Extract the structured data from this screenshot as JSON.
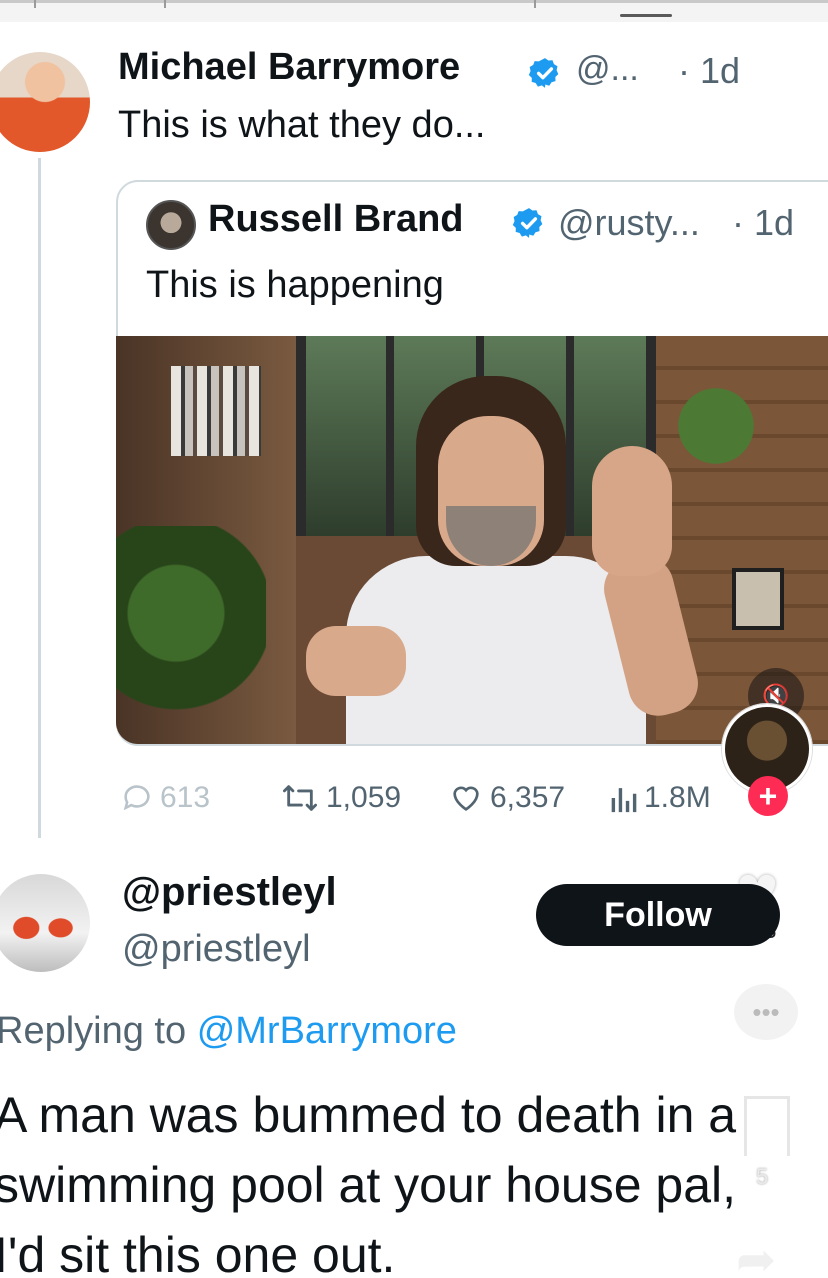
{
  "main_tweet": {
    "author_name": "Michael Barrymore",
    "handle": "@...",
    "time": "· 1d",
    "text": "This is what they do..."
  },
  "quoted_tweet": {
    "author_name": "Russell Brand",
    "handle": "@rusty...",
    "time": "· 1d",
    "text": "This is happening"
  },
  "metrics": {
    "replies": "613",
    "retweets": "1,059",
    "likes": "6,357",
    "views": "1.8M"
  },
  "reply": {
    "author_name": "@priestleyl",
    "handle": "@priestleyl",
    "follow_label": "Follow",
    "replying_prefix": "Replying to",
    "replying_mention": "@MrBarrymore",
    "text_line1": "A man was bummed to death in a",
    "text_line2": "swimming pool at your house pal,",
    "text_line3": "I'd sit this one out."
  },
  "overlay": {
    "like_count": "53",
    "bookmark_count": "5"
  },
  "icons": {
    "verified": "verified-badge-icon",
    "reply": "speech-bubble-icon",
    "retweet": "retweet-icon",
    "like": "heart-icon",
    "views": "bar-chart-icon",
    "mute": "speaker-muted-icon",
    "share": "share-arrow-icon"
  },
  "colors": {
    "verified_blue": "#1d9bf0",
    "text_primary": "#0f1419",
    "text_secondary": "#536471",
    "follow_bg": "#0f1419",
    "plus_red": "#fe2c55"
  }
}
